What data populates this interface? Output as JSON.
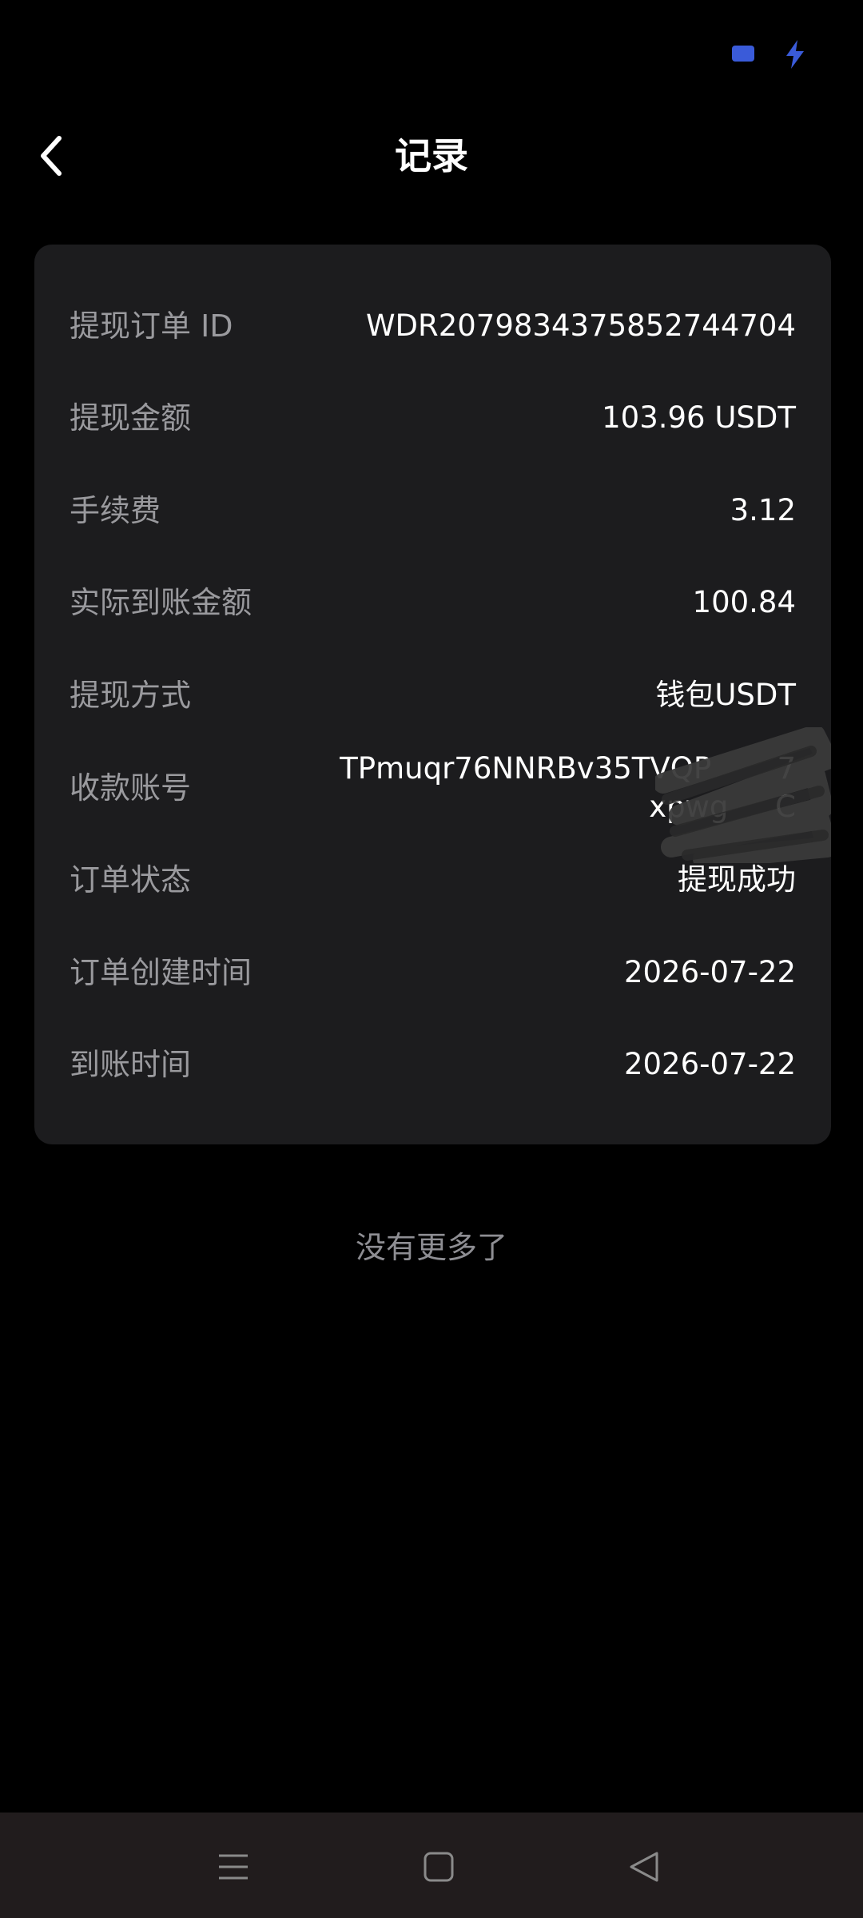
{
  "status_bar": {
    "battery_icon": "battery-icon",
    "charging_icon": "charging-bolt-icon",
    "accent_color": "#3a5bd9"
  },
  "header": {
    "title": "记录",
    "back_icon": "chevron-left-icon"
  },
  "record": {
    "rows": [
      {
        "label": "提现订单 ID",
        "value": "WDR2079834375852744704"
      },
      {
        "label": "提现金额",
        "value": "103.96 USDT"
      },
      {
        "label": "手续费",
        "value": "3.12"
      },
      {
        "label": "实际到账金额",
        "value": "100.84"
      },
      {
        "label": "提现方式",
        "value": "钱包USDT"
      },
      {
        "label": "收款账号",
        "value": "TPmuqr76NNRBv35TVQP       7xpwg     C"
      },
      {
        "label": "订单状态",
        "value": "提现成功"
      },
      {
        "label": "订单创建时间",
        "value": "2026-07-22"
      },
      {
        "label": "到账时间",
        "value": "2026-07-22"
      }
    ]
  },
  "footer": {
    "end_text": "没有更多了"
  },
  "nav_bar": {
    "menu_icon": "menu-icon",
    "home_icon": "home-square-icon",
    "back_icon": "back-triangle-icon"
  },
  "colors": {
    "background": "#000000",
    "card": "#1c1c1e",
    "label": "#9a9a9e",
    "value": "#ffffff",
    "nav_bar": "#211c1d"
  }
}
